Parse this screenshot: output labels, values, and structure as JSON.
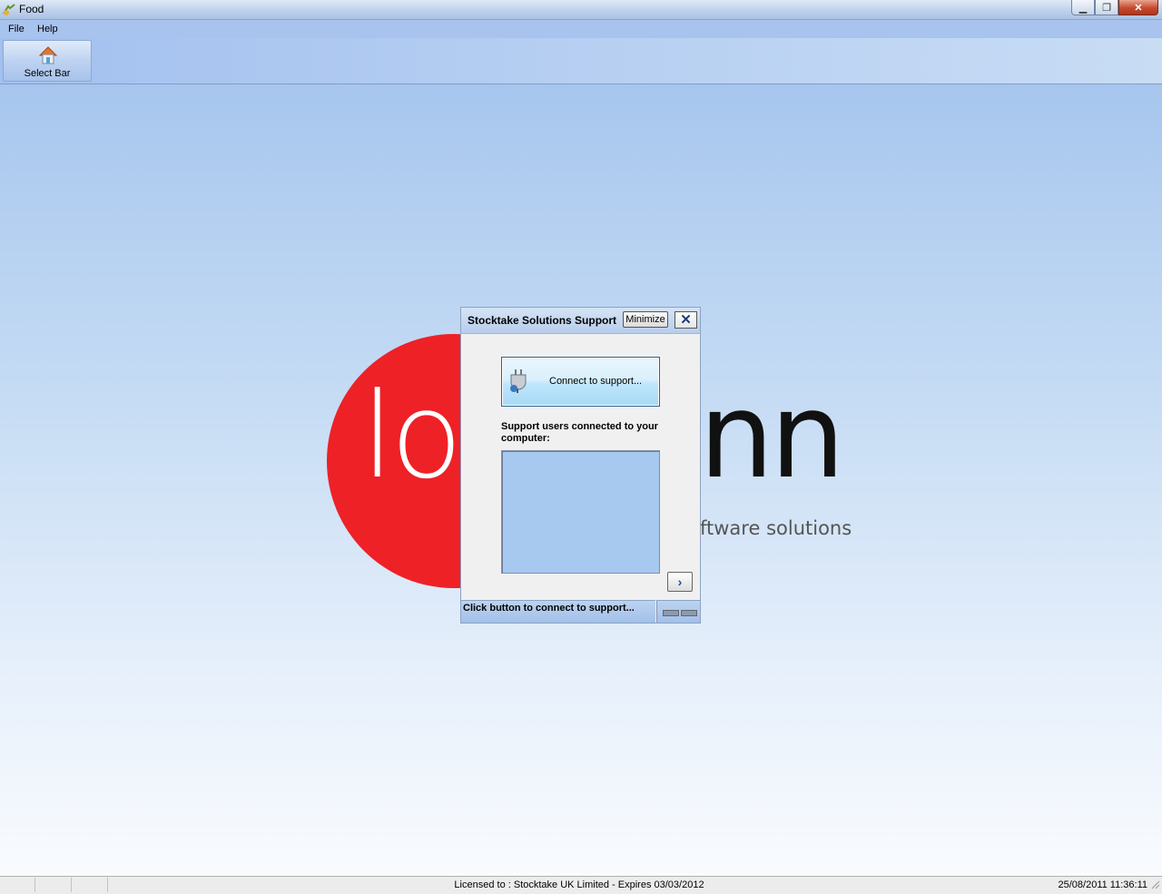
{
  "window": {
    "title": "Food",
    "icon": "food-app-icon",
    "minimize": "minimize-icon",
    "restore": "restore-icon",
    "close": "close-icon"
  },
  "menu": [
    {
      "label": "File",
      "mnemonic": "F"
    },
    {
      "label": "Help",
      "mnemonic": "H"
    }
  ],
  "toolbar": {
    "select_bar_label": "Select Bar",
    "select_bar_icon": "house-icon"
  },
  "logo": {
    "left": "lo",
    "right": "nn",
    "tagline": "ftware solutions",
    "brand_color": "#ee2127"
  },
  "support_dialog": {
    "title": "Stocktake Solutions Support",
    "minimize_label": "Minimize",
    "close_glyph": "✕",
    "connect_label": "Connect to support...",
    "users_label": "Support users connected to your computer:",
    "next_glyph": "›",
    "status": "Click button to connect to support..."
  },
  "statusbar": {
    "license": "Licensed to : Stocktake UK Limited - Expires 03/03/2012",
    "datetime": "25/08/2011 11:36:11"
  }
}
